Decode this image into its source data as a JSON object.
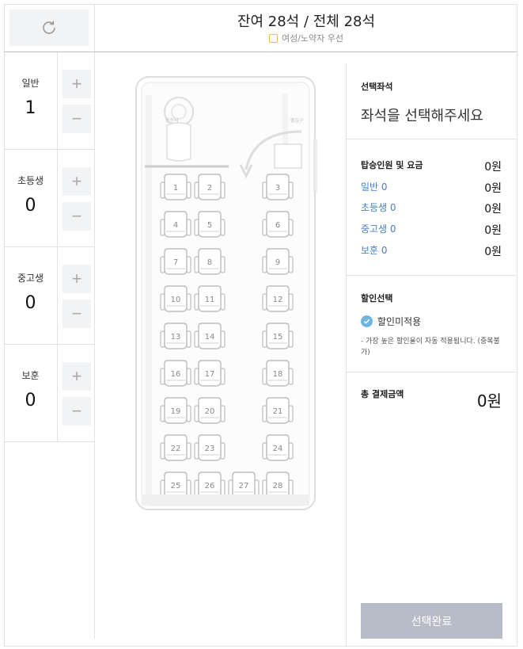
{
  "header": {
    "title": "잔여 28석 / 전체 28석",
    "filter_label": "여성/노약자 우선"
  },
  "passengers": [
    {
      "label": "일반",
      "count": "1"
    },
    {
      "label": "초등생",
      "count": "0"
    },
    {
      "label": "중고생",
      "count": "0"
    },
    {
      "label": "보훈",
      "count": "0"
    }
  ],
  "controls": {
    "plus": "+",
    "minus": "−"
  },
  "bus": {
    "driver_label": "운전석",
    "door_label": "출입구",
    "seats": [
      {
        "no": "1"
      },
      {
        "no": "2"
      },
      {
        "no": "3"
      },
      {
        "no": "4"
      },
      {
        "no": "5"
      },
      {
        "no": "6"
      },
      {
        "no": "7"
      },
      {
        "no": "8"
      },
      {
        "no": "9"
      },
      {
        "no": "10"
      },
      {
        "no": "11"
      },
      {
        "no": "12"
      },
      {
        "no": "13"
      },
      {
        "no": "14"
      },
      {
        "no": "15"
      },
      {
        "no": "16"
      },
      {
        "no": "17"
      },
      {
        "no": "18"
      },
      {
        "no": "19"
      },
      {
        "no": "20"
      },
      {
        "no": "21"
      },
      {
        "no": "22"
      },
      {
        "no": "23"
      },
      {
        "no": "24"
      },
      {
        "no": "25"
      },
      {
        "no": "26"
      },
      {
        "no": "27"
      },
      {
        "no": "28"
      }
    ]
  },
  "selection": {
    "title": "선택좌석",
    "placeholder": "좌석을 선택해주세요"
  },
  "fare": {
    "header_label": "탑승인원 및 요금",
    "header_value": "0원",
    "rows": [
      {
        "label": "일반 0",
        "value": "0원"
      },
      {
        "label": "초등생 0",
        "value": "0원"
      },
      {
        "label": "중고생 0",
        "value": "0원"
      },
      {
        "label": "보훈 0",
        "value": "0원"
      }
    ]
  },
  "discount": {
    "title": "할인선택",
    "option": "할인미적용",
    "note": "- 가장 높은 할인율이 자동 적용됩니다. (중복불가)"
  },
  "total": {
    "label": "총 결제금액",
    "value": "0원"
  },
  "complete_button": "선택완료",
  "colors": {
    "accent_link": "#4a80c2",
    "check": "#6fb6de",
    "button_disabled": "#b8bcc8",
    "checkbox_border": "#f0b74e"
  }
}
